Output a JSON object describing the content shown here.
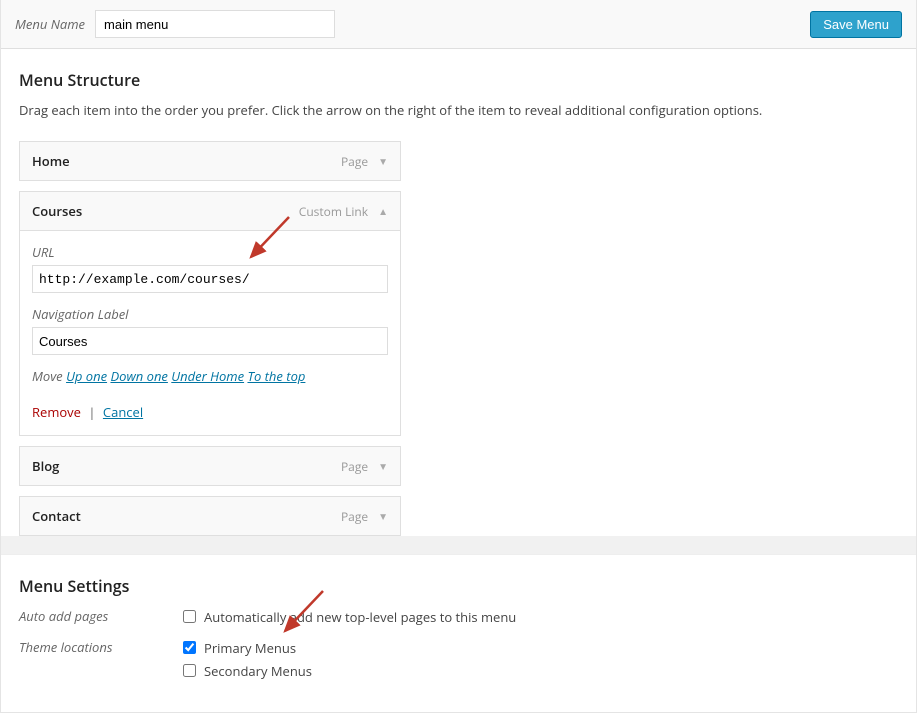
{
  "header": {
    "menuNameLabel": "Menu Name",
    "menuNameValue": "main menu",
    "saveLabel": "Save Menu"
  },
  "structure": {
    "title": "Menu Structure",
    "desc": "Drag each item into the order you prefer. Click the arrow on the right of the item to reveal additional configuration options.",
    "items": [
      {
        "title": "Home",
        "type": "Page",
        "expanded": false
      },
      {
        "title": "Courses",
        "type": "Custom Link",
        "expanded": true,
        "url": {
          "label": "URL",
          "value": "http://example.com/courses/"
        },
        "navLabel": {
          "label": "Navigation Label",
          "value": "Courses"
        },
        "move": {
          "prefix": "Move",
          "links": [
            "Up one",
            "Down one",
            "Under Home",
            "To the top"
          ]
        },
        "actions": {
          "remove": "Remove",
          "cancel": "Cancel"
        }
      },
      {
        "title": "Blog",
        "type": "Page",
        "expanded": false
      },
      {
        "title": "Contact",
        "type": "Page",
        "expanded": false
      }
    ]
  },
  "settings": {
    "title": "Menu Settings",
    "rows": [
      {
        "label": "Auto add pages",
        "options": [
          {
            "text": "Automatically add new top-level pages to this menu",
            "checked": false
          }
        ]
      },
      {
        "label": "Theme locations",
        "options": [
          {
            "text": "Primary Menus",
            "checked": true
          },
          {
            "text": "Secondary Menus",
            "checked": false
          }
        ]
      }
    ]
  }
}
